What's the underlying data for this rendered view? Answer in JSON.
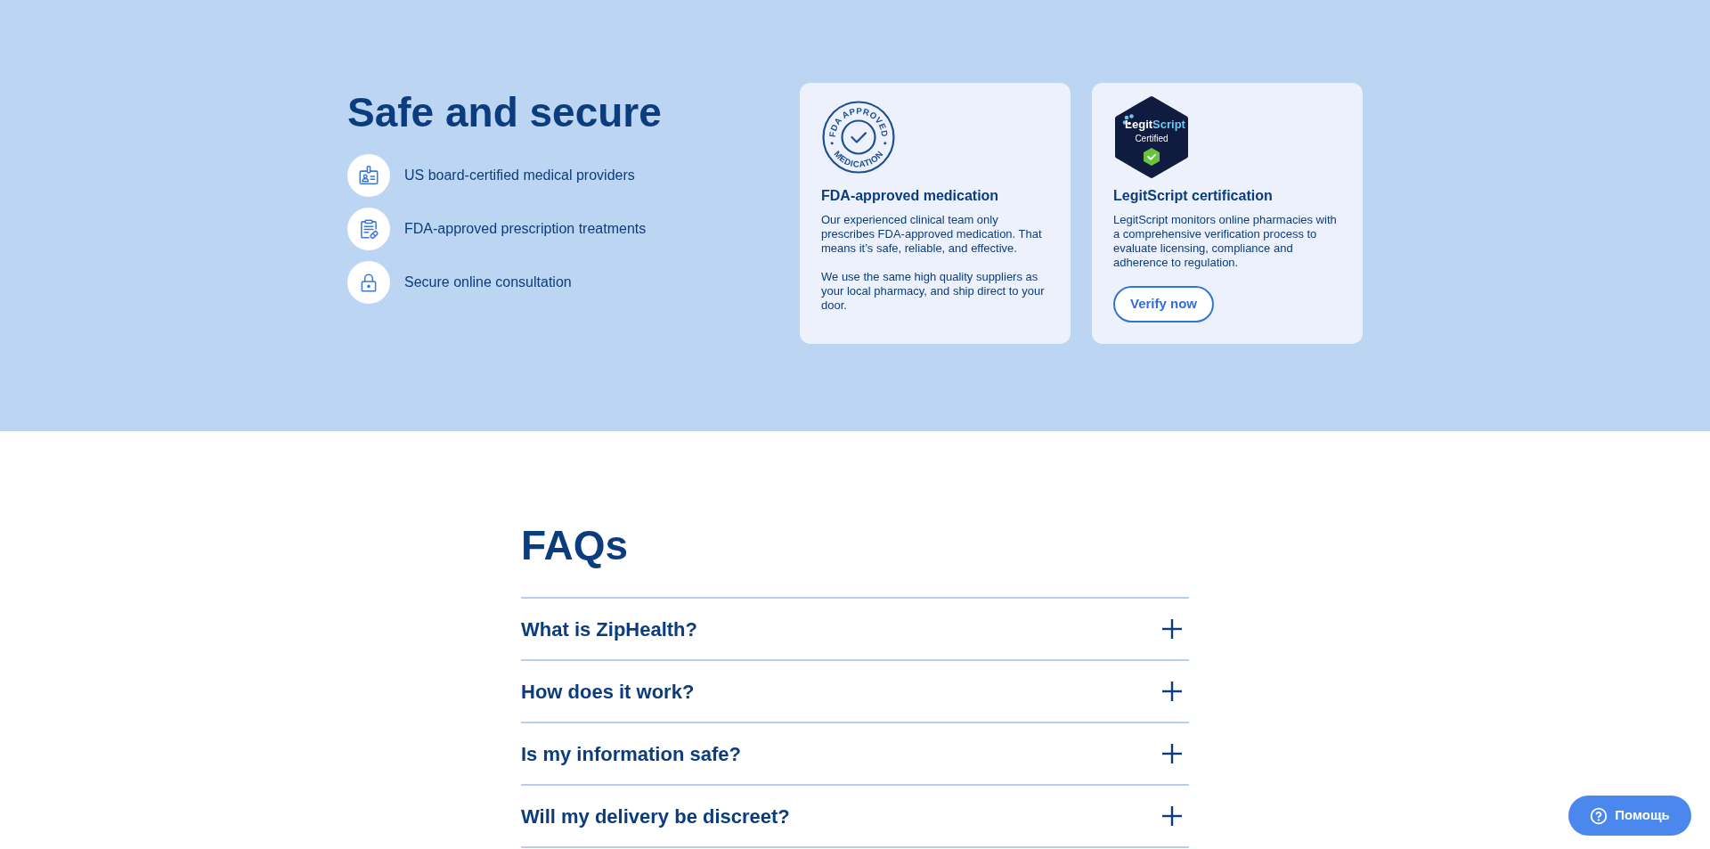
{
  "trust_section": {
    "title": "Safe and secure",
    "features": [
      {
        "kind": "badge",
        "text": "US board-certified medical providers"
      },
      {
        "kind": "prescription",
        "text": "FDA-approved prescription treatments"
      },
      {
        "kind": "lock",
        "text": "Secure online consultation"
      }
    ],
    "cards": [
      {
        "kind": "fda",
        "seal": {
          "top": "FDA APPROVED",
          "bottom": "MEDICATION"
        },
        "title": "FDA-approved medication",
        "paragraphs": [
          "Our experienced clinical team only prescribes FDA-approved medication. That means it’s safe, reliable, and effective.",
          "We use the same high quality suppliers as your local pharmacy, and ship direct to your door."
        ]
      },
      {
        "kind": "legitscript",
        "seal": {
          "brand": "Legit",
          "brand_accent": "Script",
          "caption": "Certified"
        },
        "title": "LegitScript certification",
        "paragraphs": [
          "LegitScript monitors online pharmacies with a comprehensive verification process to evaluate licensing, compliance and adherence to regulation."
        ],
        "button": "Verify now"
      }
    ]
  },
  "faq": {
    "title": "FAQs",
    "items": [
      {
        "question": "What is ZipHealth?",
        "expanded": false
      },
      {
        "question": "How does it work?",
        "expanded": false
      },
      {
        "question": "Is my information safe?",
        "expanded": false
      },
      {
        "question": "Will my delivery be discreet?",
        "expanded": false
      }
    ]
  },
  "help_button": {
    "label": "Помощь"
  }
}
